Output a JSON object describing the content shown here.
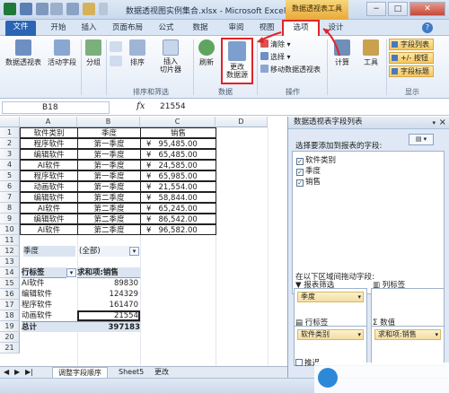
{
  "window": {
    "title": "数据透视图实例集合.xlsx - Microsoft Excel",
    "tools_tab": "数据透视表工具",
    "minimize": "−",
    "maximize": "□",
    "close": "✕"
  },
  "tabs": [
    "文件",
    "开始",
    "插入",
    "页面布局",
    "公式",
    "数据",
    "审阅",
    "视图",
    "选项",
    "设计"
  ],
  "ribbon": {
    "buttons": {
      "pivot_table": "数据透视表",
      "active_field": "活动字段",
      "group": "分组",
      "sort": "排序",
      "insert_slicer_1": "插入",
      "insert_slicer_2": "切片器",
      "refresh": "刷新",
      "change_source_1": "更改",
      "change_source_2": "数据源",
      "clear": "清除",
      "select": "选择",
      "move_pivot": "移动数据透视表",
      "calc": "计算",
      "tools": "工具",
      "field_list": "字段列表",
      "plus_minus": "+/- 按钮",
      "field_headers": "字段标题"
    },
    "group_labels": {
      "sort_filter": "排序和筛选",
      "data": "数据",
      "actions": "操作",
      "show": "显示"
    }
  },
  "formula_bar": {
    "name_box": "B18",
    "fx": "fx",
    "value": "21554"
  },
  "columns": [
    "A",
    "B",
    "C",
    "D"
  ],
  "rows": [
    {
      "n": "1",
      "a": "软件类别",
      "b": "季度",
      "c": "销售"
    },
    {
      "n": "2",
      "a": "程序软件",
      "b": "第一季度",
      "c": "¥   95,485.00"
    },
    {
      "n": "3",
      "a": "编辑软件",
      "b": "第一季度",
      "c": "¥   65,485.00"
    },
    {
      "n": "4",
      "a": "AI软件",
      "b": "第一季度",
      "c": "¥   24,585.00"
    },
    {
      "n": "5",
      "a": "程序软件",
      "b": "第一季度",
      "c": "¥   65,985.00"
    },
    {
      "n": "6",
      "a": "动画软件",
      "b": "第一季度",
      "c": "¥   21,554.00"
    },
    {
      "n": "7",
      "a": "编辑软件",
      "b": "第二季度",
      "c": "¥   58,844.00"
    },
    {
      "n": "8",
      "a": "AI软件",
      "b": "第二季度",
      "c": "¥   65,245.00"
    },
    {
      "n": "9",
      "a": "编辑软件",
      "b": "第二季度",
      "c": "¥   86,542.00"
    },
    {
      "n": "10",
      "a": "AI软件",
      "b": "第二季度",
      "c": "¥   96,582.00"
    }
  ],
  "pivot": {
    "filter": {
      "n": "12",
      "label": "季度",
      "value": "(全部)"
    },
    "blank_row": "13",
    "header": {
      "n": "14",
      "row_label": "行标签",
      "value_label": "求和项:销售"
    },
    "items": [
      {
        "n": "15",
        "label": "AI软件",
        "value": "89830"
      },
      {
        "n": "16",
        "label": "编辑软件",
        "value": "124329"
      },
      {
        "n": "17",
        "label": "程序软件",
        "value": "161470"
      },
      {
        "n": "18",
        "label": "动画软件",
        "value": "21554"
      }
    ],
    "total": {
      "n": "19",
      "label": "总计",
      "value": "397183"
    },
    "after_rows": [
      "20",
      "21"
    ]
  },
  "sheet_tabs": [
    "调整字段顺序",
    "Sheet5",
    "更改"
  ],
  "field_pane": {
    "title": "数据透视表字段列表",
    "choose_label": "选择要添加到报表的字段:",
    "fields": [
      {
        "name": "软件类别",
        "checked": true
      },
      {
        "name": "季度",
        "checked": true
      },
      {
        "name": "销售",
        "checked": true
      }
    ],
    "drag_label": "在以下区域间拖动字段:",
    "areas": {
      "report_filter": {
        "title": "报表筛选",
        "pill": "季度"
      },
      "column_labels": {
        "title": "列标签",
        "pill": ""
      },
      "row_labels": {
        "title": "行标签",
        "pill": "软件类别"
      },
      "values": {
        "title": "数值",
        "pill": "求和项:销售"
      }
    },
    "defer_label": "推迟"
  },
  "colors": {
    "highlight": "#e0242a",
    "file_tab": "#2a64b3",
    "tools_tab": "#f0b84a"
  }
}
